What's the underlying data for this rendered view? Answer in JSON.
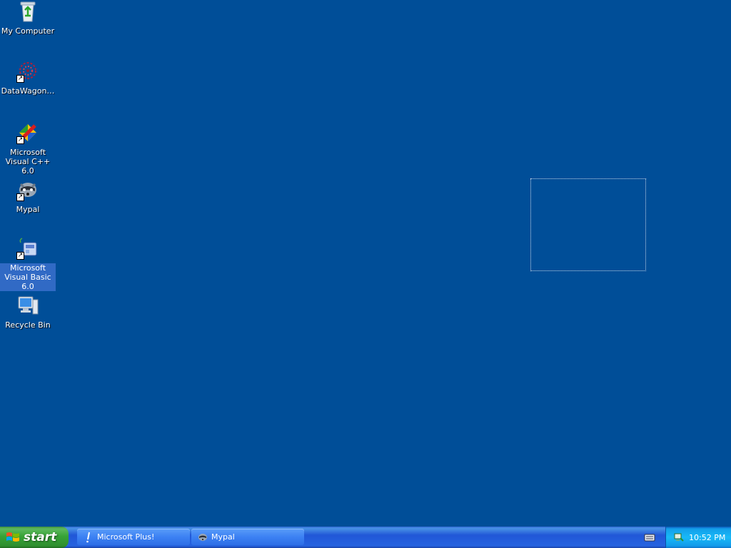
{
  "desktop": {
    "background_color": "#004e98",
    "icons": [
      {
        "label": "My Computer",
        "icon": "recycle-icon",
        "shortcut": false,
        "selected": false
      },
      {
        "label": "DataWagon…",
        "icon": "datawagon-icon",
        "shortcut": true,
        "selected": false
      },
      {
        "label": "Microsoft Visual C++ 6.0",
        "icon": "visual-cpp-icon",
        "shortcut": true,
        "selected": false
      },
      {
        "label": "Mypal",
        "icon": "raccoon-icon",
        "shortcut": true,
        "selected": true
      },
      {
        "label": "Microsoft Visual Basic 6.0",
        "icon": "visual-basic-icon",
        "shortcut": true,
        "selected": true
      },
      {
        "label": "Recycle Bin",
        "icon": "computer-icon",
        "shortcut": false,
        "selected": false
      }
    ]
  },
  "taskbar": {
    "start_label": "start",
    "tasks": [
      {
        "label": "Microsoft Plus!",
        "icon": "exclamation-icon"
      },
      {
        "label": "Mypal",
        "icon": "raccoon-icon"
      }
    ],
    "tray": {
      "clock": "10:52 PM",
      "icons": [
        "keyboard-icon",
        "network-icon"
      ]
    }
  }
}
